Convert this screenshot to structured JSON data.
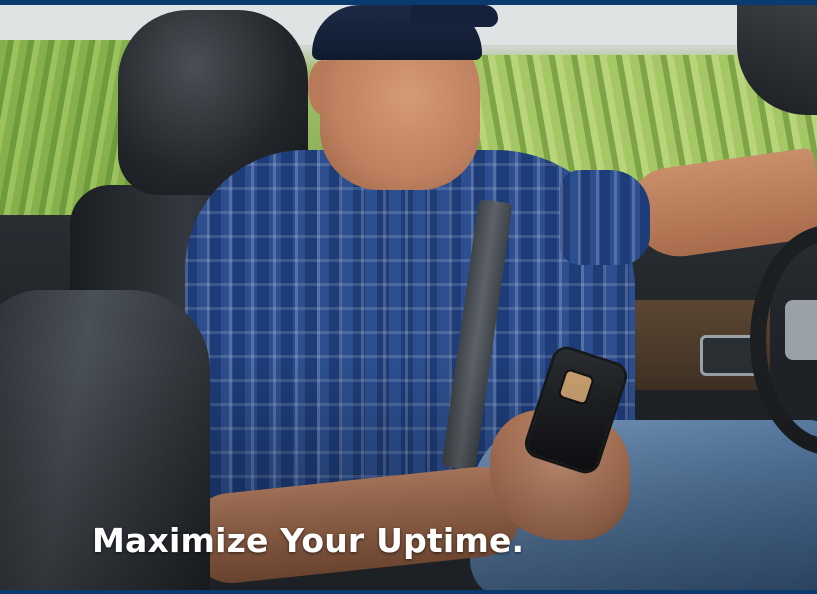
{
  "headline": "Maximize Your Uptime.",
  "colors": {
    "accent_bar": "#0b3a6e",
    "headline_text": "#ffffff"
  }
}
